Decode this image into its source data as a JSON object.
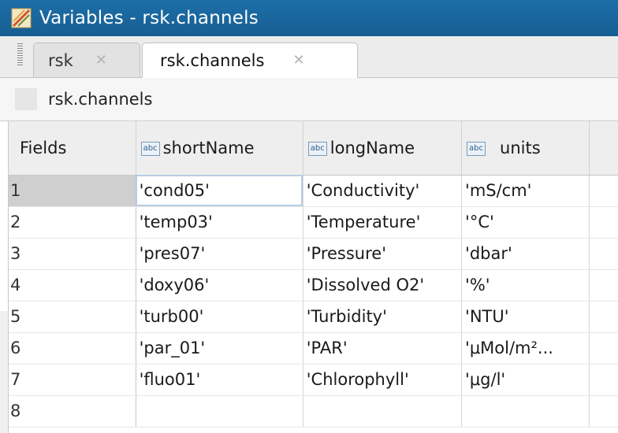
{
  "window": {
    "title": "Variables - rsk.channels"
  },
  "tabs": [
    {
      "label": "rsk",
      "active": false
    },
    {
      "label": "rsk.channels",
      "active": true
    }
  ],
  "pathbar": {
    "path": "rsk.channels"
  },
  "table": {
    "row_header_label": "Fields",
    "columns": [
      {
        "badge": "abc",
        "label": "shortName"
      },
      {
        "badge": "abc",
        "label": "longName"
      },
      {
        "badge": "abc",
        "label": "units"
      }
    ],
    "rows": [
      {
        "num": "1",
        "cells": [
          "'cond05'",
          "'Conductivity'",
          "'mS/cm'"
        ]
      },
      {
        "num": "2",
        "cells": [
          "'temp03'",
          "'Temperature'",
          "'°C'"
        ]
      },
      {
        "num": "3",
        "cells": [
          "'pres07'",
          "'Pressure'",
          "'dbar'"
        ]
      },
      {
        "num": "4",
        "cells": [
          "'doxy06'",
          "'Dissolved O2'",
          "'%'"
        ]
      },
      {
        "num": "5",
        "cells": [
          "'turb00'",
          "'Turbidity'",
          "'NTU'"
        ]
      },
      {
        "num": "6",
        "cells": [
          "'par_01'",
          "'PAR'",
          "'μMol/m²..."
        ]
      },
      {
        "num": "7",
        "cells": [
          "'fluo01'",
          "'Chlorophyll'",
          "'μg/l'"
        ]
      },
      {
        "num": "8",
        "cells": [
          "",
          "",
          ""
        ]
      }
    ]
  },
  "colors": {
    "titlebar": "#1b6aa3",
    "selection_outline": "#b7cde3"
  }
}
